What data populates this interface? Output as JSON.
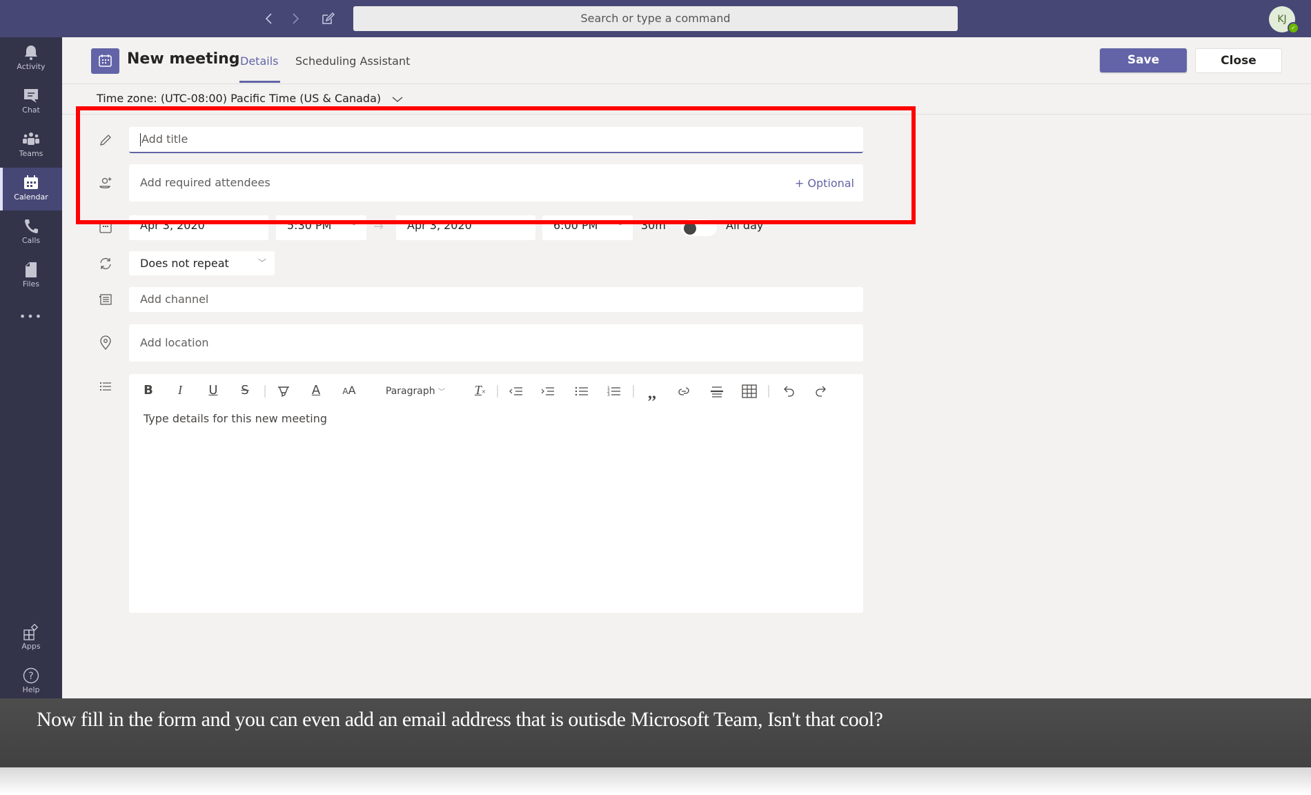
{
  "topbar": {
    "back_icon": "chevron-left-icon",
    "forward_icon": "chevron-right-icon",
    "compose_icon": "compose-icon",
    "search_placeholder": "Search or type a command",
    "avatar_initials": "KJ",
    "presence_status": "available"
  },
  "sidebar": {
    "items": [
      {
        "label": "Activity",
        "icon": "bell-icon",
        "active": false
      },
      {
        "label": "Chat",
        "icon": "chat-icon",
        "active": false
      },
      {
        "label": "Teams",
        "icon": "teams-icon",
        "active": false
      },
      {
        "label": "Calendar",
        "icon": "calendar-icon",
        "active": true
      },
      {
        "label": "Calls",
        "icon": "phone-icon",
        "active": false
      },
      {
        "label": "Files",
        "icon": "file-icon",
        "active": false
      }
    ],
    "more_label": "•••",
    "bottom_items": [
      {
        "label": "Apps",
        "icon": "apps-icon"
      },
      {
        "label": "Help",
        "icon": "help-icon"
      }
    ]
  },
  "header": {
    "title": "New meeting",
    "tabs": [
      {
        "label": "Details",
        "active": true
      },
      {
        "label": "Scheduling Assistant",
        "active": false
      }
    ],
    "save_label": "Save",
    "close_label": "Close"
  },
  "form": {
    "timezone": "Time zone: (UTC-08:00) Pacific Time (US & Canada)",
    "title_placeholder": "Add title",
    "attendees_placeholder": "Add required attendees",
    "optional_label": "+ Optional",
    "start_date": "Apr 3, 2020",
    "start_time": "5:30 PM",
    "end_date": "Apr 3, 2020",
    "end_time": "6:00 PM",
    "duration": "30m",
    "all_day_label": "All day",
    "all_day_on": false,
    "repeat_value": "Does not repeat",
    "channel_placeholder": "Add channel",
    "location_placeholder": "Add location",
    "details_placeholder": "Type details for this new meeting"
  },
  "editor_toolbar": {
    "paragraph_label": "Paragraph",
    "tools": [
      "bold",
      "italic",
      "underline",
      "strikethrough",
      "highlight",
      "font-color",
      "font-size",
      "paragraph",
      "clear-formatting",
      "decrease-indent",
      "increase-indent",
      "bulleted-list",
      "numbered-list",
      "quote",
      "link",
      "horizontal-rule",
      "table",
      "undo",
      "redo"
    ]
  },
  "annotation": {
    "highlight_color": "#ff0000",
    "caption": "Now fill in the form and you can even add an email address that is outisde Microsoft Team, Isn't that cool?"
  },
  "colors": {
    "brand": "#6264a7",
    "topbar": "#464775",
    "sidebar": "#33344a",
    "background": "#f3f2f1"
  }
}
